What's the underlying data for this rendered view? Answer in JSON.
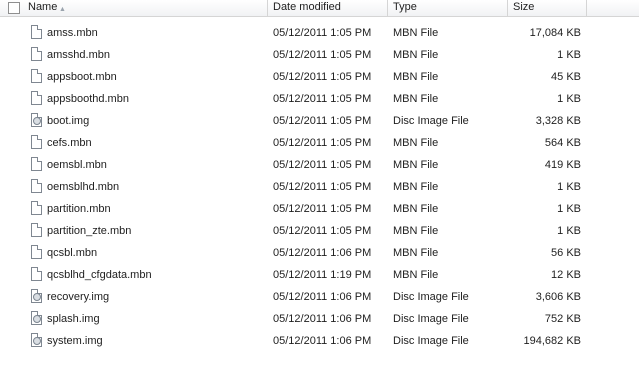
{
  "columns": {
    "name": "Name",
    "date": "Date modified",
    "type": "Type",
    "size": "Size"
  },
  "files": [
    {
      "name": "amss.mbn",
      "date": "05/12/2011 1:05 PM",
      "type": "MBN File",
      "size": "17,084 KB",
      "icon": "file-icon"
    },
    {
      "name": "amsshd.mbn",
      "date": "05/12/2011 1:05 PM",
      "type": "MBN File",
      "size": "1 KB",
      "icon": "file-icon"
    },
    {
      "name": "appsboot.mbn",
      "date": "05/12/2011 1:05 PM",
      "type": "MBN File",
      "size": "45 KB",
      "icon": "file-icon"
    },
    {
      "name": "appsboothd.mbn",
      "date": "05/12/2011 1:05 PM",
      "type": "MBN File",
      "size": "1 KB",
      "icon": "file-icon"
    },
    {
      "name": "boot.img",
      "date": "05/12/2011 1:05 PM",
      "type": "Disc Image File",
      "size": "3,328 KB",
      "icon": "disc-image-icon"
    },
    {
      "name": "cefs.mbn",
      "date": "05/12/2011 1:05 PM",
      "type": "MBN File",
      "size": "564 KB",
      "icon": "file-icon"
    },
    {
      "name": "oemsbl.mbn",
      "date": "05/12/2011 1:05 PM",
      "type": "MBN File",
      "size": "419 KB",
      "icon": "file-icon"
    },
    {
      "name": "oemsblhd.mbn",
      "date": "05/12/2011 1:05 PM",
      "type": "MBN File",
      "size": "1 KB",
      "icon": "file-icon"
    },
    {
      "name": "partition.mbn",
      "date": "05/12/2011 1:05 PM",
      "type": "MBN File",
      "size": "1 KB",
      "icon": "file-icon"
    },
    {
      "name": "partition_zte.mbn",
      "date": "05/12/2011 1:05 PM",
      "type": "MBN File",
      "size": "1 KB",
      "icon": "file-icon"
    },
    {
      "name": "qcsbl.mbn",
      "date": "05/12/2011 1:06 PM",
      "type": "MBN File",
      "size": "56 KB",
      "icon": "file-icon"
    },
    {
      "name": "qcsblhd_cfgdata.mbn",
      "date": "05/12/2011 1:19 PM",
      "type": "MBN File",
      "size": "12 KB",
      "icon": "file-icon"
    },
    {
      "name": "recovery.img",
      "date": "05/12/2011 1:06 PM",
      "type": "Disc Image File",
      "size": "3,606 KB",
      "icon": "disc-image-icon"
    },
    {
      "name": "splash.img",
      "date": "05/12/2011 1:06 PM",
      "type": "Disc Image File",
      "size": "752 KB",
      "icon": "disc-image-icon"
    },
    {
      "name": "system.img",
      "date": "05/12/2011 1:06 PM",
      "type": "Disc Image File",
      "size": "194,682 KB",
      "icon": "disc-image-icon"
    }
  ]
}
